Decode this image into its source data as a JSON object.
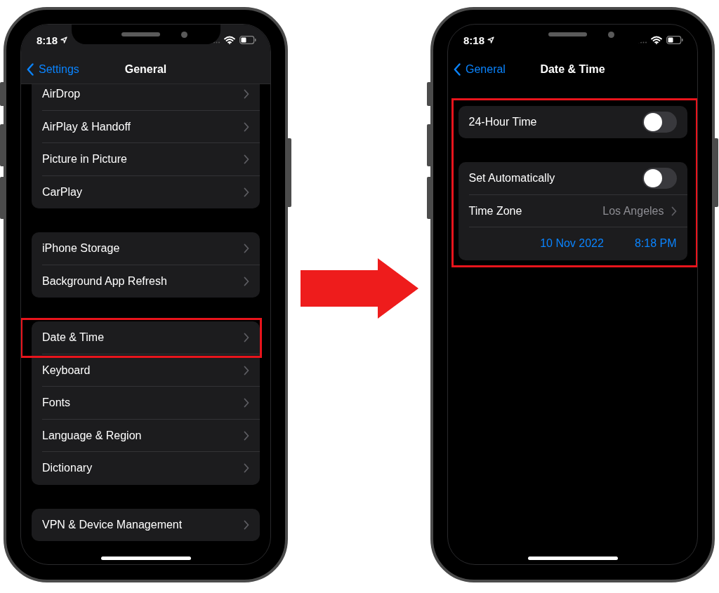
{
  "screens": [
    {
      "status_time": "8:18",
      "nav": {
        "back": "Settings",
        "title": "General"
      },
      "groups_highlighted": false,
      "scrolled": true,
      "groups": [
        {
          "rows": [
            {
              "kind": "link",
              "label": "AirDrop",
              "highlighted": false
            },
            {
              "kind": "link",
              "label": "AirPlay & Handoff",
              "highlighted": false
            },
            {
              "kind": "link",
              "label": "Picture in Picture",
              "highlighted": false
            },
            {
              "kind": "link",
              "label": "CarPlay",
              "highlighted": false
            }
          ]
        },
        {
          "rows": [
            {
              "kind": "link",
              "label": "iPhone Storage",
              "highlighted": false
            },
            {
              "kind": "link",
              "label": "Background App Refresh",
              "highlighted": false
            }
          ]
        },
        {
          "rows": [
            {
              "kind": "link",
              "label": "Date & Time",
              "highlighted": true
            },
            {
              "kind": "link",
              "label": "Keyboard",
              "highlighted": false
            },
            {
              "kind": "link",
              "label": "Fonts",
              "highlighted": false
            },
            {
              "kind": "link",
              "label": "Language & Region",
              "highlighted": false
            },
            {
              "kind": "link",
              "label": "Dictionary",
              "highlighted": false
            }
          ]
        },
        {
          "rows": [
            {
              "kind": "link",
              "label": "VPN & Device Management",
              "highlighted": false
            }
          ]
        }
      ]
    },
    {
      "status_time": "8:18",
      "nav": {
        "back": "General",
        "title": "Date & Time"
      },
      "groups_highlighted": true,
      "scrolled": false,
      "groups": [
        {
          "rows": [
            {
              "kind": "toggle",
              "label": "24-Hour Time",
              "on": false
            }
          ]
        },
        {
          "rows": [
            {
              "kind": "toggle",
              "label": "Set Automatically",
              "on": false
            },
            {
              "kind": "link",
              "label": "Time Zone",
              "value": "Los Angeles"
            },
            {
              "kind": "datetime",
              "date": "10 Nov 2022",
              "time": "8:18 PM"
            }
          ]
        }
      ]
    }
  ]
}
